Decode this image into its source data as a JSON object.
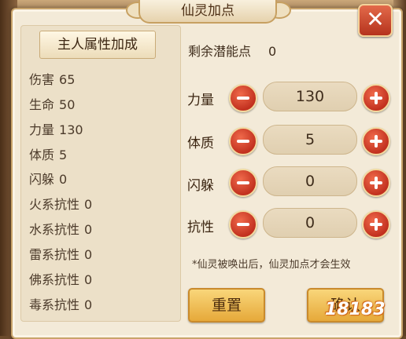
{
  "dialog": {
    "title": "仙灵加点",
    "close_label": "✕"
  },
  "owner_tab_label": "主人属性加成",
  "stats": [
    {
      "name": "伤害",
      "value": "65"
    },
    {
      "name": "生命",
      "value": "50"
    },
    {
      "name": "力量",
      "value": "130"
    },
    {
      "name": "体质",
      "value": "5"
    },
    {
      "name": "闪躲",
      "value": "0"
    },
    {
      "name": "火系抗性",
      "value": "0"
    },
    {
      "name": "水系抗性",
      "value": "0"
    },
    {
      "name": "雷系抗性",
      "value": "0"
    },
    {
      "name": "佛系抗性",
      "value": "0"
    },
    {
      "name": "毒系抗性",
      "value": "0"
    }
  ],
  "remaining": {
    "label": "剩余潜能点",
    "value": "0"
  },
  "attributes": [
    {
      "label": "力量",
      "value": "130"
    },
    {
      "label": "体质",
      "value": "5"
    },
    {
      "label": "闪躲",
      "value": "0"
    },
    {
      "label": "抗性",
      "value": "0"
    }
  ],
  "note": "*仙灵被唤出后，仙灵加点才会生效",
  "buttons": {
    "reset": "重置",
    "confirm": "确认"
  },
  "watermark": "18183",
  "colors": {
    "accent_red": "#c2311f",
    "button_gold": "#e6a93a",
    "panel_bg": "#f3ead8"
  }
}
